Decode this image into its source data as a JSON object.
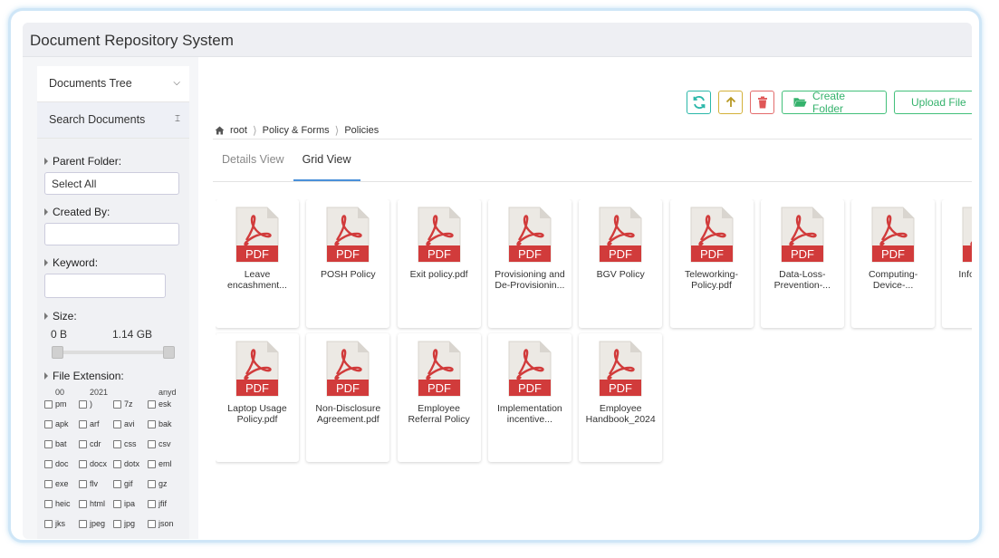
{
  "app": {
    "title": "Document Repository System"
  },
  "sidebar": {
    "tree_label": "Documents Tree",
    "search_label": "Search Documents",
    "parent_folder": {
      "label": "Parent Folder:",
      "value": "Select All"
    },
    "created_by": {
      "label": "Created By:",
      "value": ""
    },
    "keyword": {
      "label": "Keyword:",
      "value": ""
    },
    "size": {
      "label": "Size:",
      "min": "0 B",
      "max": "1.14 GB"
    },
    "file_extension": {
      "label": "File Extension:",
      "header": [
        "00",
        "2021",
        "",
        "anyd"
      ],
      "items": [
        "pm",
        ")",
        "7z",
        "esk",
        "apk",
        "arf",
        "avi",
        "bak",
        "bat",
        "cdr",
        "css",
        "csv",
        "doc",
        "docx",
        "dotx",
        "eml",
        "exe",
        "flv",
        "gif",
        "gz",
        "heic",
        "html",
        "ipa",
        "jfif",
        "jks",
        "jpeg",
        "jpg",
        "json"
      ]
    }
  },
  "toolbar": {
    "refresh_icon": "refresh-icon",
    "up_icon": "arrow-up-icon",
    "delete_icon": "trash-icon",
    "create_folder": "Create Folder",
    "upload_file": "Upload File"
  },
  "breadcrumb": {
    "root": "root",
    "level1": "Policy & Forms",
    "level2": "Policies"
  },
  "tabs": {
    "details": "Details View",
    "grid": "Grid View"
  },
  "files": [
    {
      "name": "Leave encashment..."
    },
    {
      "name": "POSH Policy"
    },
    {
      "name": "Exit policy.pdf"
    },
    {
      "name": "Provisioning and De-Provisionin..."
    },
    {
      "name": "BGV Policy"
    },
    {
      "name": "Teleworking-Policy.pdf"
    },
    {
      "name": "Data-Loss-Prevention-..."
    },
    {
      "name": "Computing-Device-..."
    },
    {
      "name": "Infor... Tra..."
    },
    {
      "name": "Laptop Usage Policy.pdf"
    },
    {
      "name": "Non-Disclosure Agreement.pdf"
    },
    {
      "name": "Employee Referral Policy"
    },
    {
      "name": "Implementation incentive..."
    },
    {
      "name": "Employee Handbook_2024"
    }
  ],
  "pdf_label": "PDF",
  "colors": {
    "accent": "#4a90d9",
    "pdf_red": "#d13b3b",
    "green": "#35b26c",
    "teal": "#2ab7a9"
  }
}
